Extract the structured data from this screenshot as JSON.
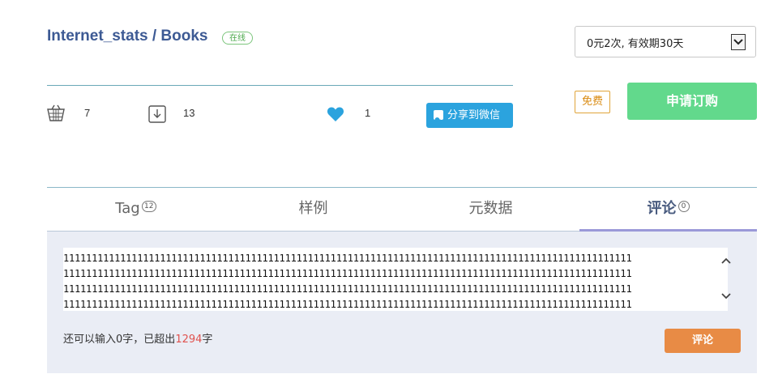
{
  "header": {
    "title": "Internet_stats / Books",
    "status_badge": "在线"
  },
  "plan_select": {
    "selected": "0元2次, 有效期30天"
  },
  "stats": {
    "cart_count": "7",
    "download_count": "13",
    "like_count": "1",
    "share_label": "分享到微信"
  },
  "purchase": {
    "free_label": "免费",
    "apply_label": "申请订购"
  },
  "tabs": [
    {
      "label": "Tag",
      "count": "12"
    },
    {
      "label": "样例"
    },
    {
      "label": "元数据"
    },
    {
      "label": "评论",
      "count": "0"
    }
  ],
  "comment": {
    "text": "1111111111111111111111111111111111111111111111111111111111111111111111111111111111111111111111111111\n1111111111111111111111111111111111111111111111111111111111111111111111111111111111111111111111111111\n1111111111111111111111111111111111111111111111111111111111111111111111111111111111111111111111111111\n1111111111111111111111111111111111111111111111111111111111111111111111111111111111111111111111111111",
    "remain_prefix": "还可以输入",
    "remain_count": "0",
    "remain_mid": "字，已超出",
    "over_count": "1294",
    "remain_suffix": "字",
    "submit_label": "评论"
  },
  "colors": {
    "title": "#3d5a94",
    "share_button": "#2ba3de",
    "apply_button": "#62d98c",
    "comment_button": "#e88b45",
    "over_count": "#e0534f",
    "heart": "#2ba3de"
  }
}
